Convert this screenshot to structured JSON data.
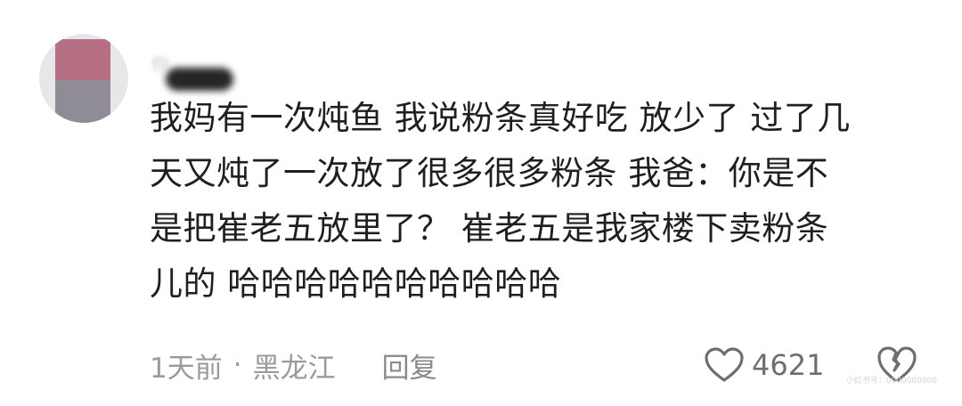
{
  "comment": {
    "username": "你……",
    "lines": [
      "我妈有一次炖鱼 我说粉条真好吃 放少了 过了几",
      "天又炖了一次放了很多很多粉条 我爸：你是不",
      "是把崔老五放里了？ 崔老五是我家楼下卖粉条",
      "儿的 哈哈哈哈哈哈哈哈哈哈"
    ],
    "time": "1天前",
    "separator": "·",
    "location": "黑龙江",
    "reply_label": "回复",
    "like_count": "4621",
    "watermark": "小红书号：0000000000"
  },
  "icons": {
    "like": "heart-outline-icon",
    "dislike": "broken-heart-icon"
  },
  "colors": {
    "text": "#1f1f1f",
    "meta": "#9a9a9a",
    "icon": "#6e6e6e"
  }
}
